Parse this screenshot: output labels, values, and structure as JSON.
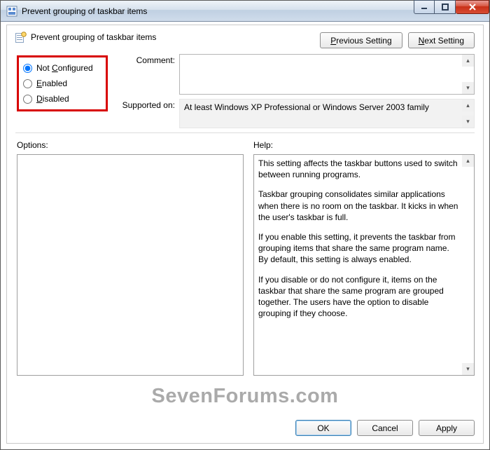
{
  "window": {
    "title": "Prevent grouping of taskbar items"
  },
  "header": {
    "policy_name": "Prevent grouping of taskbar items",
    "prev_button": "Previous Setting",
    "next_button": "Next Setting"
  },
  "state": {
    "not_configured_label": "Not Configured",
    "enabled_label": "Enabled",
    "disabled_label": "Disabled",
    "selected": "not_configured"
  },
  "fields": {
    "comment_label": "Comment:",
    "comment_value": "",
    "supported_label": "Supported on:",
    "supported_value": "At least Windows XP Professional or Windows Server 2003 family"
  },
  "panels": {
    "options_label": "Options:",
    "help_label": "Help:",
    "help_paragraphs": [
      "This setting affects the taskbar buttons used to switch between running programs.",
      "Taskbar grouping consolidates similar applications when there is no room on the taskbar. It kicks in when the user's taskbar is full.",
      "If you enable this setting, it prevents the taskbar from grouping items that share the same program name. By default, this setting is always enabled.",
      "If you disable or do not configure it, items on the taskbar that share the same program are grouped together. The users have the option to disable grouping if they choose."
    ]
  },
  "footer": {
    "ok": "OK",
    "cancel": "Cancel",
    "apply": "Apply"
  },
  "watermark": "SevenForums.com"
}
